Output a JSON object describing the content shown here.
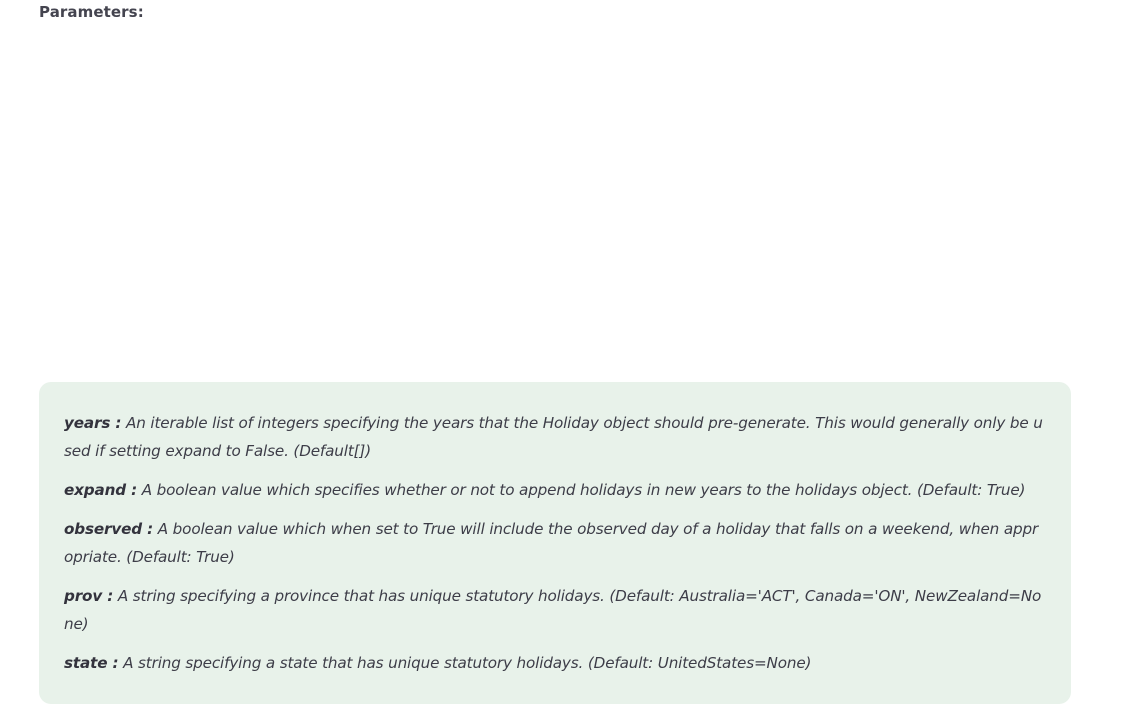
{
  "heading": "Parameters:",
  "params": [
    {
      "name": "years :",
      "description": "An iterable list of integers specifying the years that the Holiday object should pre-generate. This would generally only be used if setting expand to False. (Default[])"
    },
    {
      "name": "expand :",
      "description": "A boolean value which specifies whether or not to append holidays in new years to the holidays object. (Default: True)"
    },
    {
      "name": "observed :",
      "description": "A boolean value which when set to True will include the observed day of a holiday that falls on a weekend, when appropriate. (Default: True)"
    },
    {
      "name": "prov :",
      "description": "A string specifying a province that has unique statutory holidays. (Default: Australia='ACT', Canada='ON', NewZealand=None)"
    },
    {
      "name": "state :",
      "description": "A string specifying a state that has unique statutory holidays. (Default: UnitedStates=None)"
    }
  ]
}
